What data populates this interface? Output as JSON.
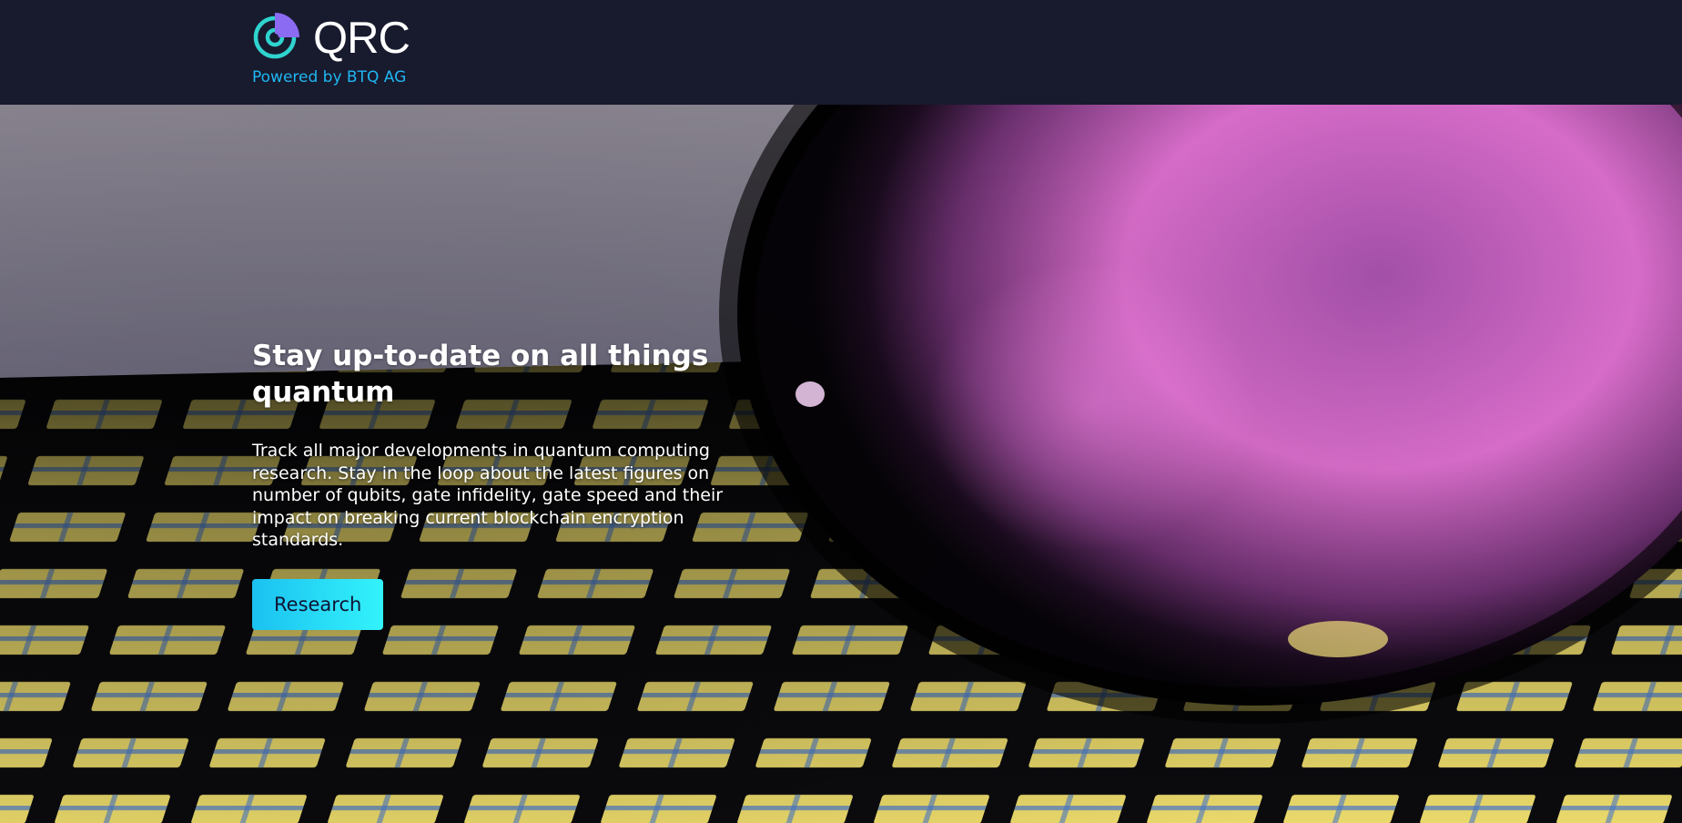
{
  "header": {
    "logo_text": "QRC",
    "tagline": "Powered by BTQ AG",
    "logo_icon": "qrc-logo-icon"
  },
  "hero": {
    "title": "Stay up-to-date on all things quantum",
    "description": "Track all major developments in quantum computing research. Stay in the loop about the latest figures on number of qubits, gate infidelity, gate speed and their impact on breaking current blockchain encryption standards.",
    "cta_label": "Research",
    "background_image": "quantum-chip-sphere-photo"
  },
  "colors": {
    "header_bg": "#181a2e",
    "accent_cyan": "#1fb7f2",
    "button_gradient_start": "#1bc1f0",
    "button_gradient_end": "#33f3fb",
    "logo_teal": "#2fd3cf",
    "logo_violet": "#8b6bf2"
  }
}
